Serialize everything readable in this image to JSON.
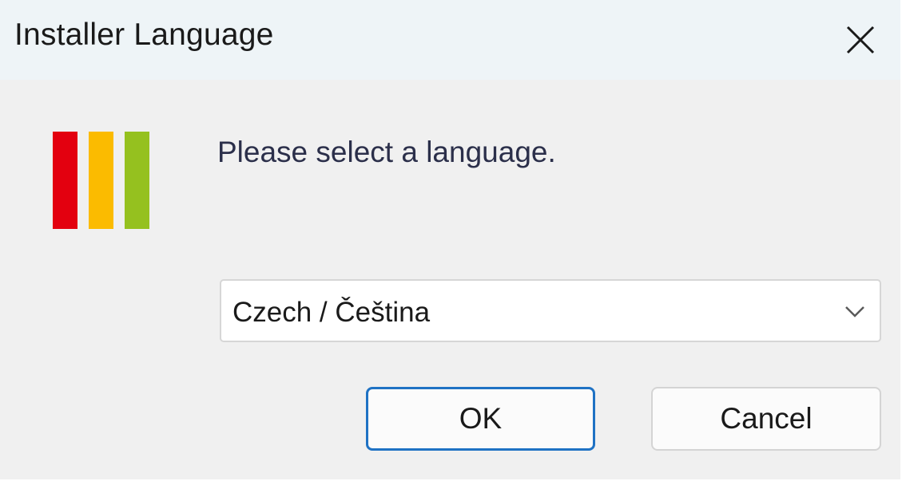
{
  "window": {
    "title": "Installer Language",
    "close_icon": "close-icon"
  },
  "logo": {
    "icon": "installer-logo-icon",
    "colors": [
      "#e3000f",
      "#fbbb00",
      "#95c11f"
    ]
  },
  "prompt": "Please select a language.",
  "language_select": {
    "selected": "Czech / Čeština",
    "icon": "chevron-down-icon"
  },
  "buttons": {
    "ok": "OK",
    "cancel": "Cancel"
  },
  "colors": {
    "accent": "#1f72c4",
    "titlebar_bg": "#eef4f7",
    "dialog_bg": "#f0f0f0"
  }
}
